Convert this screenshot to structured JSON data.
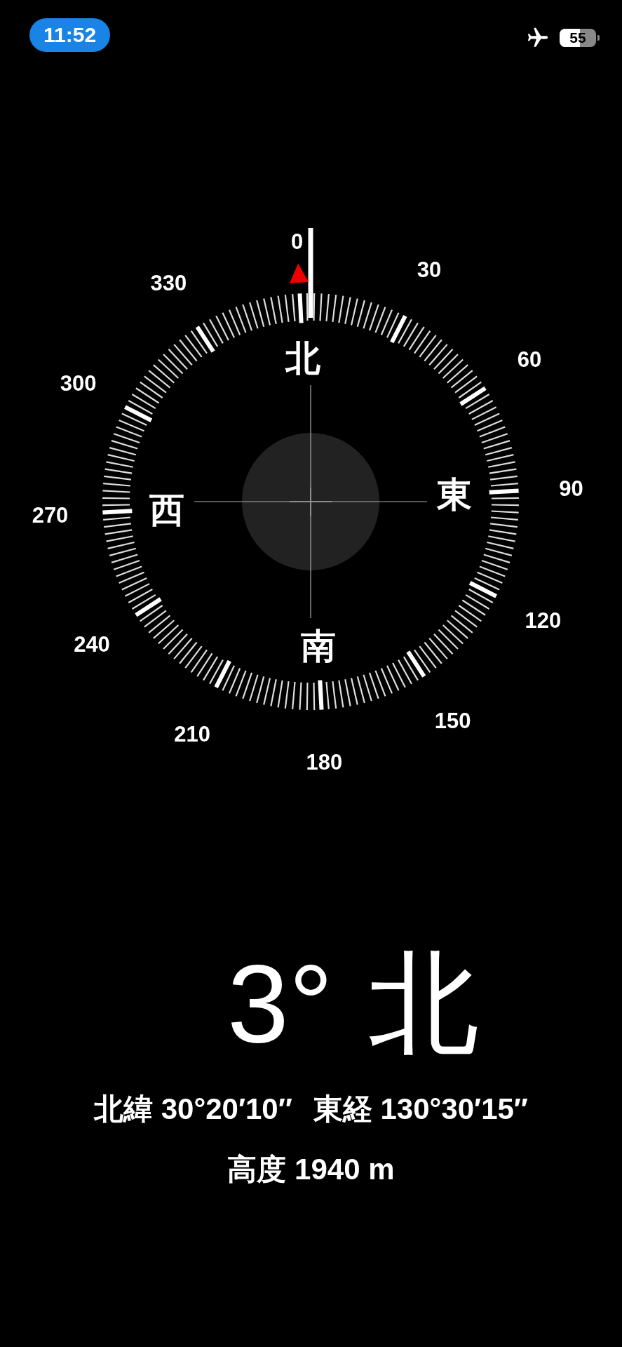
{
  "status_bar": {
    "time": "11:52",
    "battery": "55"
  },
  "compass": {
    "dial_labels": [
      "0",
      "30",
      "60",
      "90",
      "120",
      "150",
      "180",
      "210",
      "240",
      "270",
      "300",
      "330"
    ],
    "cardinals": [
      "北",
      "東",
      "南",
      "西"
    ]
  },
  "heading": {
    "degrees": "3°",
    "direction": "北"
  },
  "location": {
    "latitude": "北緯 30°20′10″",
    "longitude": "東経 130°30′15″",
    "altitude": "高度 1940 m"
  }
}
